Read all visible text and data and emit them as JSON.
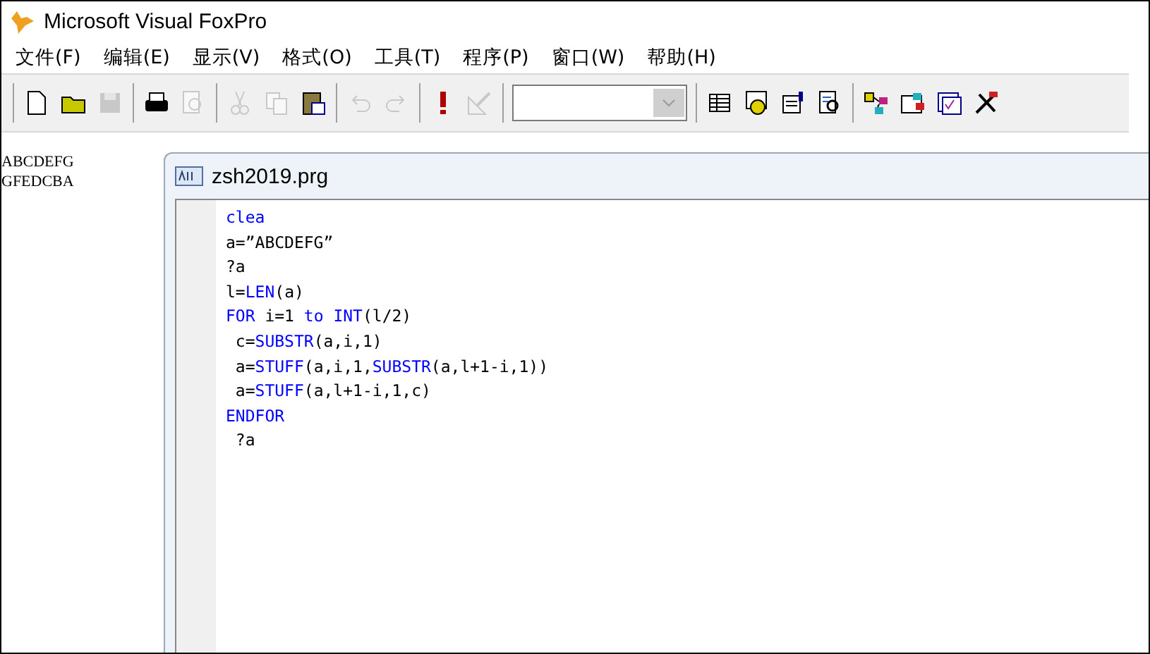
{
  "window": {
    "title": "Microsoft Visual FoxPro"
  },
  "menu": [
    "文件(F)",
    "编辑(E)",
    "显示(V)",
    "格式(O)",
    "工具(T)",
    "程序(P)",
    "窗口(W)",
    "帮助(H)"
  ],
  "toolbar": {
    "groups": [
      [
        {
          "kind": "new",
          "disabled": false
        },
        {
          "kind": "open",
          "disabled": false
        },
        {
          "kind": "save",
          "disabled": true
        }
      ],
      [
        {
          "kind": "print",
          "disabled": false
        },
        {
          "kind": "preview",
          "disabled": true
        }
      ],
      [
        {
          "kind": "cut",
          "disabled": true
        },
        {
          "kind": "copy",
          "disabled": true
        },
        {
          "kind": "paste",
          "disabled": false
        }
      ],
      [
        {
          "kind": "undo",
          "disabled": true
        },
        {
          "kind": "redo",
          "disabled": true
        }
      ],
      [
        {
          "kind": "run",
          "disabled": false
        },
        {
          "kind": "modify",
          "disabled": true
        }
      ],
      [
        {
          "kind": "combo",
          "disabled": false
        }
      ],
      [
        {
          "kind": "grid",
          "disabled": false
        },
        {
          "kind": "database",
          "disabled": false
        },
        {
          "kind": "properties",
          "disabled": false
        },
        {
          "kind": "code",
          "disabled": false
        }
      ],
      [
        {
          "kind": "connect",
          "disabled": false
        },
        {
          "kind": "forms",
          "disabled": false
        },
        {
          "kind": "checklist",
          "disabled": false
        },
        {
          "kind": "tools",
          "disabled": false
        }
      ]
    ]
  },
  "output": [
    "ABCDEFG",
    "GFEDCBA"
  ],
  "editor": {
    "title": "zsh2019.prg",
    "lines": [
      [
        {
          "text": "clea",
          "kind": "kw"
        }
      ],
      [
        {
          "text": "a=”ABCDEFG”",
          "kind": "plain"
        }
      ],
      [
        {
          "text": "?a",
          "kind": "plain"
        }
      ],
      [
        {
          "text": "l=",
          "kind": "plain"
        },
        {
          "text": "LEN",
          "kind": "kw"
        },
        {
          "text": "(a)",
          "kind": "plain"
        }
      ],
      [
        {
          "text": "FOR",
          "kind": "kw"
        },
        {
          "text": " i=1 ",
          "kind": "plain"
        },
        {
          "text": "to ",
          "kind": "kw"
        },
        {
          "text": "INT",
          "kind": "kw"
        },
        {
          "text": "(l/2)",
          "kind": "plain"
        }
      ],
      [
        {
          "text": " c=",
          "kind": "plain"
        },
        {
          "text": "SUBSTR",
          "kind": "kw"
        },
        {
          "text": "(a,i,1)",
          "kind": "plain"
        }
      ],
      [
        {
          "text": " a=",
          "kind": "plain"
        },
        {
          "text": "STUFF",
          "kind": "kw"
        },
        {
          "text": "(a,i,1,",
          "kind": "plain"
        },
        {
          "text": "SUBSTR",
          "kind": "kw"
        },
        {
          "text": "(a,l+1-i,1))",
          "kind": "plain"
        }
      ],
      [
        {
          "text": " a=",
          "kind": "plain"
        },
        {
          "text": "STUFF",
          "kind": "kw"
        },
        {
          "text": "(a,l+1-i,1,c)",
          "kind": "plain"
        }
      ],
      [
        {
          "text": "ENDFOR",
          "kind": "kw"
        }
      ],
      [
        {
          "text": " ?a",
          "kind": "plain"
        }
      ]
    ]
  }
}
